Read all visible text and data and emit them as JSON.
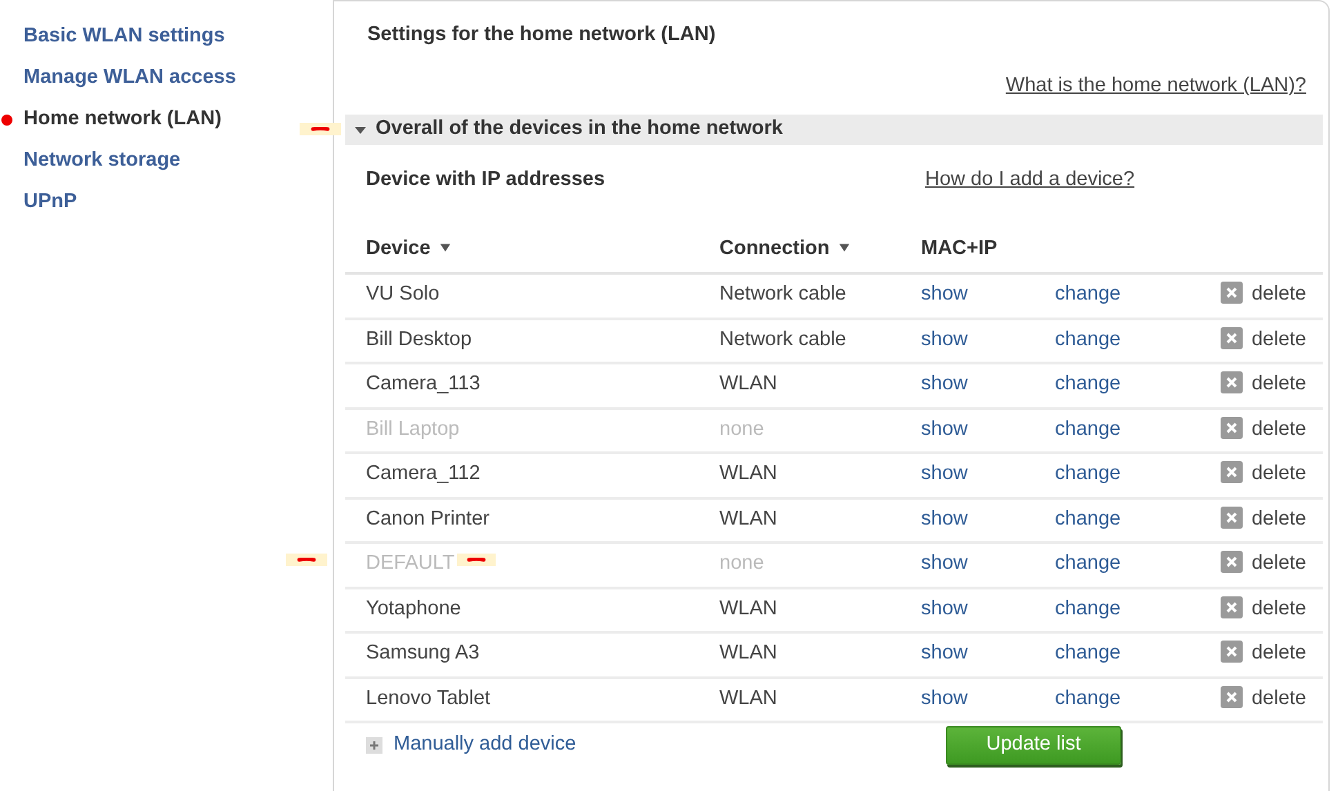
{
  "sidebar": {
    "items": [
      {
        "label": "Basic WLAN settings",
        "selected": false
      },
      {
        "label": "Manage WLAN access",
        "selected": false
      },
      {
        "label": "Home network (LAN)",
        "selected": true
      },
      {
        "label": "Network storage",
        "selected": false
      },
      {
        "label": "UPnP",
        "selected": false
      }
    ]
  },
  "title": "Settings for the home network (LAN)",
  "help_link": "What is the home network (LAN)?",
  "section": {
    "label": "Overall of the devices in the home network",
    "expanded": true,
    "marked": true
  },
  "subheading": "Device with IP addresses",
  "add_help_link": "How do I add a device?",
  "table": {
    "columns": [
      {
        "label": "Device",
        "sortable": true
      },
      {
        "label": "Connection",
        "sortable": true
      },
      {
        "label": "MAC+IP",
        "sortable": false
      }
    ],
    "rows": [
      {
        "device": "VU Solo",
        "connection": "Network cable",
        "show": "show",
        "change": "change",
        "delete": "delete",
        "inactive": false,
        "marked": false
      },
      {
        "device": "Bill Desktop",
        "connection": "Network cable",
        "show": "show",
        "change": "change",
        "delete": "delete",
        "inactive": false,
        "marked": false
      },
      {
        "device": "Camera_113",
        "connection": "WLAN",
        "show": "show",
        "change": "change",
        "delete": "delete",
        "inactive": false,
        "marked": false
      },
      {
        "device": "Bill Laptop",
        "connection": "none",
        "show": "show",
        "change": "change",
        "delete": "delete",
        "inactive": true,
        "marked": false
      },
      {
        "device": "Camera_112",
        "connection": "WLAN",
        "show": "show",
        "change": "change",
        "delete": "delete",
        "inactive": false,
        "marked": false
      },
      {
        "device": "Canon Printer",
        "connection": "WLAN",
        "show": "show",
        "change": "change",
        "delete": "delete",
        "inactive": false,
        "marked": false
      },
      {
        "device": "DEFAULT",
        "connection": "none",
        "show": "show",
        "change": "change",
        "delete": "delete",
        "inactive": true,
        "marked": true
      },
      {
        "device": "Yotaphone",
        "connection": "WLAN",
        "show": "show",
        "change": "change",
        "delete": "delete",
        "inactive": false,
        "marked": false
      },
      {
        "device": "Samsung A3",
        "connection": "WLAN",
        "show": "show",
        "change": "change",
        "delete": "delete",
        "inactive": false,
        "marked": false
      },
      {
        "device": "Lenovo Tablet",
        "connection": "WLAN",
        "show": "show",
        "change": "change",
        "delete": "delete",
        "inactive": false,
        "marked": false
      }
    ]
  },
  "add_device": "Manually add device",
  "update_button": "Update list"
}
